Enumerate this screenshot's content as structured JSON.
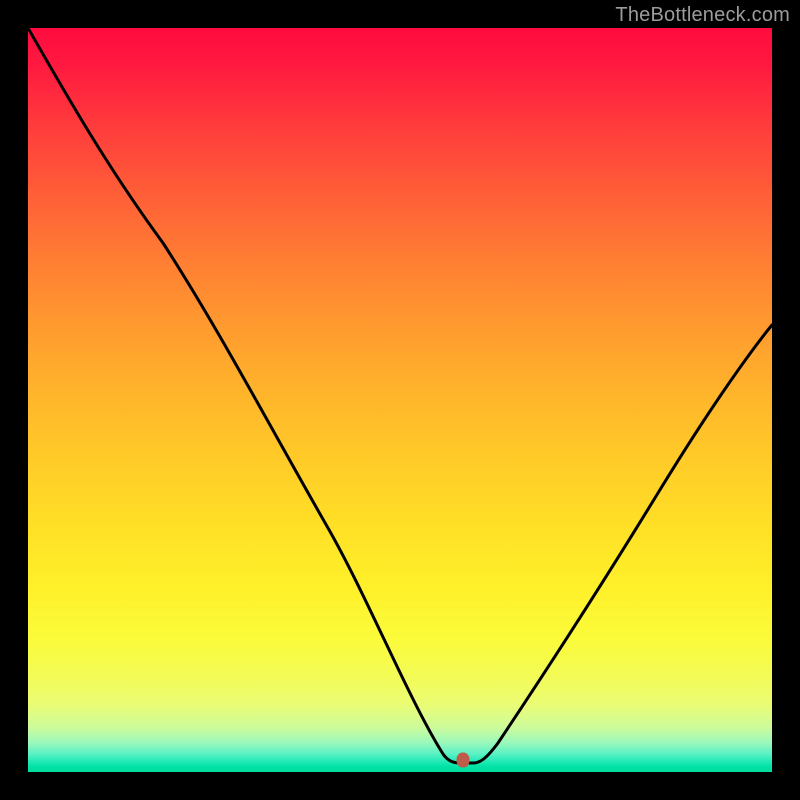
{
  "watermark": "TheBottleneck.com",
  "marker": {
    "x_frac": 0.585,
    "y_frac": 0.984
  },
  "chart_data": {
    "type": "line",
    "title": "",
    "xlabel": "",
    "ylabel": "",
    "xlim": [
      0,
      1
    ],
    "ylim": [
      0,
      1
    ],
    "series": [
      {
        "name": "curve",
        "x": [
          0.0,
          0.06,
          0.12,
          0.18,
          0.24,
          0.3,
          0.36,
          0.42,
          0.48,
          0.53,
          0.565,
          0.6,
          0.64,
          0.7,
          0.76,
          0.82,
          0.88,
          0.94,
          1.0
        ],
        "y": [
          1.0,
          0.9,
          0.8,
          0.71,
          0.62,
          0.53,
          0.44,
          0.34,
          0.23,
          0.11,
          0.02,
          0.02,
          0.06,
          0.16,
          0.26,
          0.36,
          0.45,
          0.53,
          0.6
        ]
      }
    ],
    "marker_points": [
      {
        "x": 0.585,
        "y": 0.016
      }
    ],
    "background_gradient": {
      "top": "#ff0b3e",
      "mid": "#ffd427",
      "bottom": "#00dd9b"
    }
  }
}
